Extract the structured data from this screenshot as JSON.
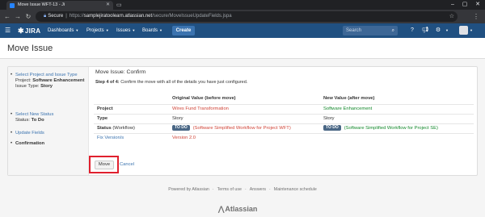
{
  "browser": {
    "tab_title": "Move Issue WFT-13 - Ji",
    "url_secure_label": "Secure",
    "url_scheme": "https://",
    "url_host": "samplejiratoolearn.atlassian.net",
    "url_path": "/secure/MoveIssueUpdateFields.jspa"
  },
  "header": {
    "logo_text": "JIRA",
    "nav": [
      "Dashboards",
      "Projects",
      "Issues",
      "Boards"
    ],
    "create_label": "Create",
    "search_placeholder": "Search",
    "brand_color": "#205081"
  },
  "page": {
    "title": "Move Issue"
  },
  "sidebar": {
    "steps": [
      {
        "label": "Select Project and Issue Type",
        "project_label": "Project:",
        "project_value": "Software Enhancement",
        "type_label": "Issue Type:",
        "type_value": "Story"
      },
      {
        "label": "Select New Status",
        "status_label": "Status:",
        "status_value": "To Do"
      },
      {
        "label": "Update Fields"
      },
      {
        "label": "Confirmation"
      }
    ]
  },
  "main": {
    "title": "Move Issue: Confirm",
    "step_number": "Step 4 of 4:",
    "step_text": "Confirm the move with all of the details you have just configured.",
    "columns": [
      "",
      "Original Value (before move)",
      "New Value (after move)"
    ],
    "rows": {
      "project": {
        "label": "Project",
        "old": "Wires Fund Transformation",
        "new": "Software Enhancement"
      },
      "type": {
        "label": "Type",
        "old": "Story",
        "new": "Story"
      },
      "status": {
        "label": "Status",
        "label_note": "(Workflow)",
        "old_badge": "TO DO",
        "old_workflow": "(Software Simplified Workflow for Project WFT)",
        "new_badge": "TO DO",
        "new_workflow": "(Software Simplified Workflow for Project SE)"
      },
      "fix": {
        "label": "Fix Version/s",
        "old": "Version 2.0",
        "new": ""
      }
    },
    "move_label": "Move",
    "cancel_label": "Cancel"
  },
  "footer": {
    "links": [
      "Powered by Atlassian",
      "Terms of use",
      "Answers",
      "Maintenance schedule"
    ],
    "logo": "Atlassian"
  }
}
